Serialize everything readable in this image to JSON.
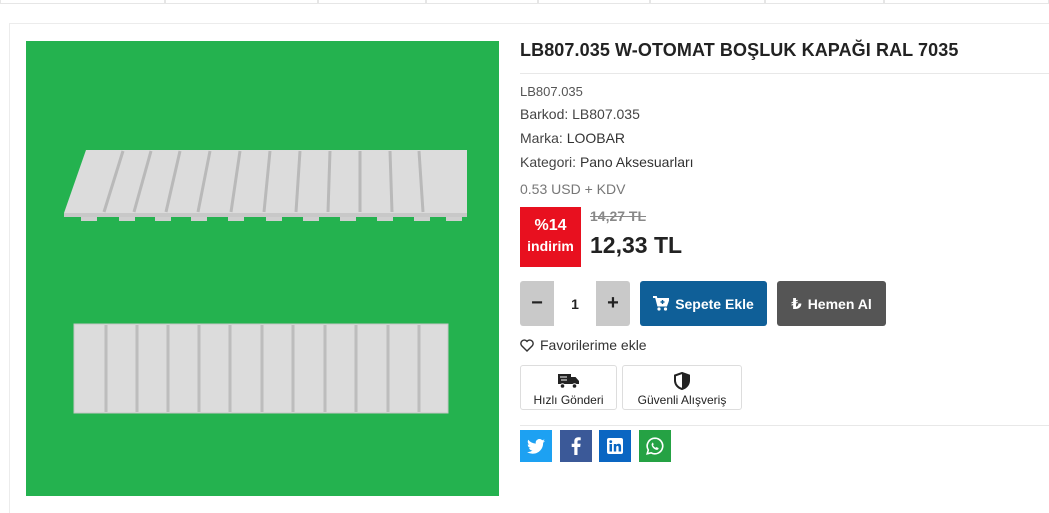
{
  "product": {
    "title": "LB807.035 W-OTOMAT BOŞLUK KAPAĞI RAL 7035",
    "code": "LB807.035",
    "barkod": "Barkod: LB807.035",
    "marka_label": "Marka: ",
    "marka": "LOOBAR",
    "kategori_label": "Kategori: ",
    "kategori": "Pano Aksesuarları",
    "usd_price": "0.53 USD + KDV"
  },
  "pricing": {
    "discount_percent": "%14",
    "discount_label": "indirim",
    "old_price": "14,27 TL",
    "new_price": "12,33 TL"
  },
  "quantity": {
    "minus": "−",
    "value": "1",
    "plus": "+"
  },
  "actions": {
    "add_to_cart": "Sepete Ekle",
    "buy_now": "Hemen Al",
    "favorite": "Favorilerime ekle"
  },
  "features": [
    {
      "label": "Hızlı Gönderi",
      "icon": "truck-icon"
    },
    {
      "label": "Güvenli Alışveriş",
      "icon": "shield-icon"
    }
  ],
  "share": [
    {
      "network": "twitter",
      "icon": "twitter-icon",
      "color": "#1da1f2"
    },
    {
      "network": "facebook",
      "icon": "facebook-icon",
      "color": "#3b5998"
    },
    {
      "network": "linkedin",
      "icon": "linkedin-icon",
      "color": "#0a66c2"
    },
    {
      "network": "whatsapp",
      "icon": "whatsapp-icon",
      "color": "#25a244"
    }
  ],
  "colors": {
    "image_background": "#24b24f",
    "discount_badge": "#e8101f",
    "cart_button": "#0f5f98",
    "buy_button": "#555555"
  }
}
